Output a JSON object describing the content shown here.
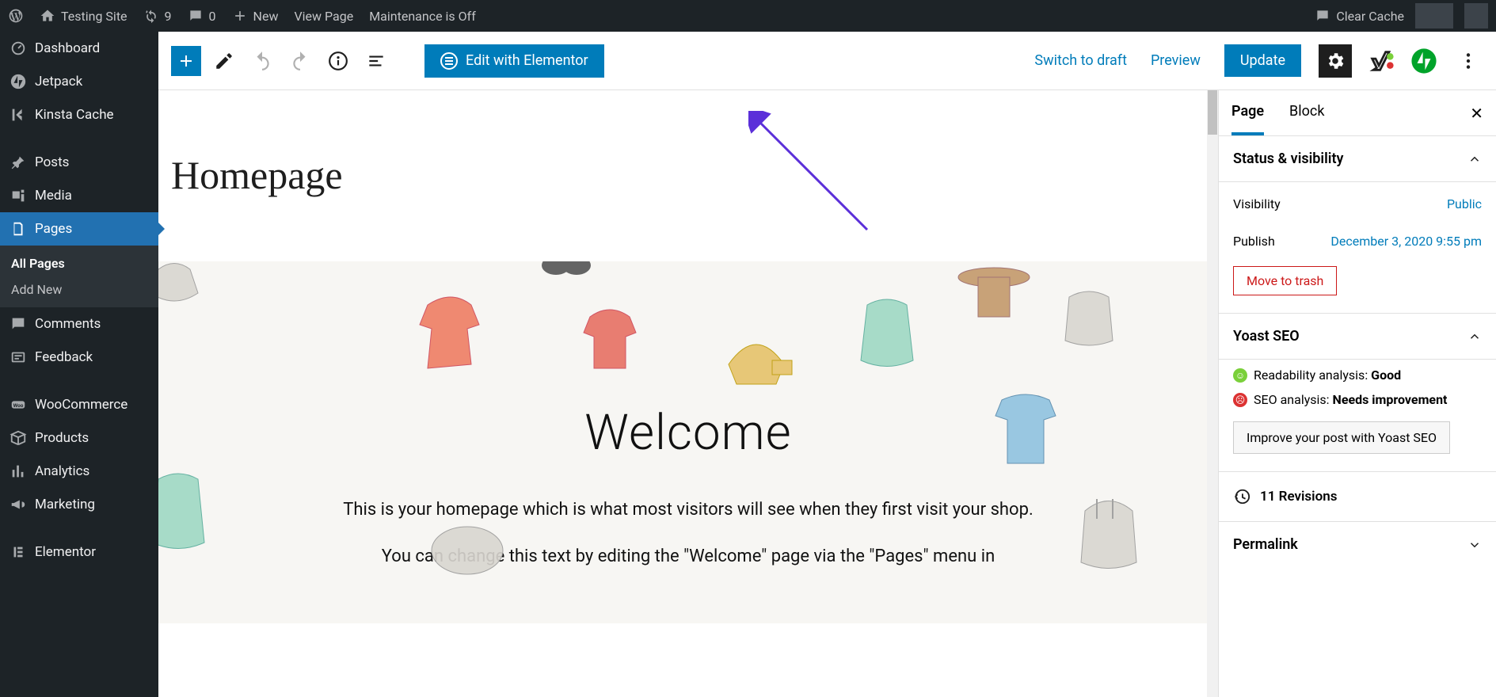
{
  "admin_bar": {
    "site_name": "Testing Site",
    "updates_count": "9",
    "comments_count": "0",
    "new_label": "New",
    "view_page": "View Page",
    "maintenance": "Maintenance is Off",
    "clear_cache": "Clear Cache"
  },
  "sidebar": {
    "items": [
      {
        "label": "Dashboard",
        "icon": "dashboard-icon"
      },
      {
        "label": "Jetpack",
        "icon": "jetpack-icon"
      },
      {
        "label": "Kinsta Cache",
        "icon": "kinsta-icon"
      },
      {
        "label": "Posts",
        "icon": "pin-icon"
      },
      {
        "label": "Media",
        "icon": "media-icon"
      },
      {
        "label": "Pages",
        "icon": "pages-icon",
        "active": true
      },
      {
        "label": "Comments",
        "icon": "comment-icon"
      },
      {
        "label": "Feedback",
        "icon": "feedback-icon"
      },
      {
        "label": "WooCommerce",
        "icon": "woo-icon"
      },
      {
        "label": "Products",
        "icon": "products-icon"
      },
      {
        "label": "Analytics",
        "icon": "analytics-icon"
      },
      {
        "label": "Marketing",
        "icon": "marketing-icon"
      },
      {
        "label": "Elementor",
        "icon": "elementor-icon"
      }
    ],
    "submenu": {
      "all_pages": "All Pages",
      "add_new": "Add New"
    }
  },
  "toolbar": {
    "elementor_label": "Edit with Elementor",
    "switch_draft": "Switch to draft",
    "preview": "Preview",
    "update": "Update"
  },
  "canvas": {
    "page_title": "Homepage",
    "hero_title": "Welcome",
    "hero_p1": "This is your homepage which is what most visitors will see when they first visit your shop.",
    "hero_p2": "You can change this text by editing the \"Welcome\" page via the \"Pages\" menu in"
  },
  "settings": {
    "tabs": {
      "page": "Page",
      "block": "Block"
    },
    "status_head": "Status & visibility",
    "visibility_label": "Visibility",
    "visibility_value": "Public",
    "publish_label": "Publish",
    "publish_value": "December 3, 2020 9:55 pm",
    "trash": "Move to trash",
    "yoast_head": "Yoast SEO",
    "readability_label": "Readability analysis: ",
    "readability_value": "Good",
    "seo_label": "SEO analysis: ",
    "seo_value": "Needs improvement",
    "improve_label": "Improve your post with Yoast SEO",
    "revisions_count": "11 Revisions",
    "permalink_head": "Permalink"
  }
}
